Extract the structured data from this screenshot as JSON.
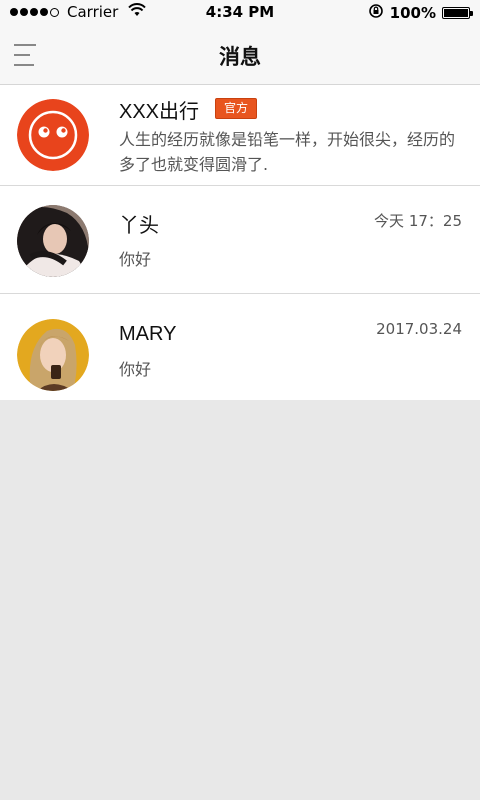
{
  "status_bar": {
    "carrier": "Carrier",
    "time": "4:34 PM",
    "battery": "100%",
    "signal_icon": "signal-dots-icon",
    "wifi_icon": "wifi-icon",
    "lock_icon": "orientation-lock-icon",
    "battery_icon": "battery-icon"
  },
  "nav": {
    "title": "消息",
    "menu_icon": "menu-icon"
  },
  "colors": {
    "badge": "#e8551f",
    "avatar_brand": "#e8441c",
    "background": "#e8e8e8"
  },
  "messages": [
    {
      "name": "XXX出行",
      "badge": "官方",
      "preview": "人生的经历就像是铅笔一样，开始很尖，经历的多了也就变得圆滑了.",
      "time": ""
    },
    {
      "name": "丫头",
      "preview": "你好",
      "time": "今天 17：25"
    },
    {
      "name": "MARY",
      "preview": "你好",
      "time": "2017.03.24"
    }
  ]
}
